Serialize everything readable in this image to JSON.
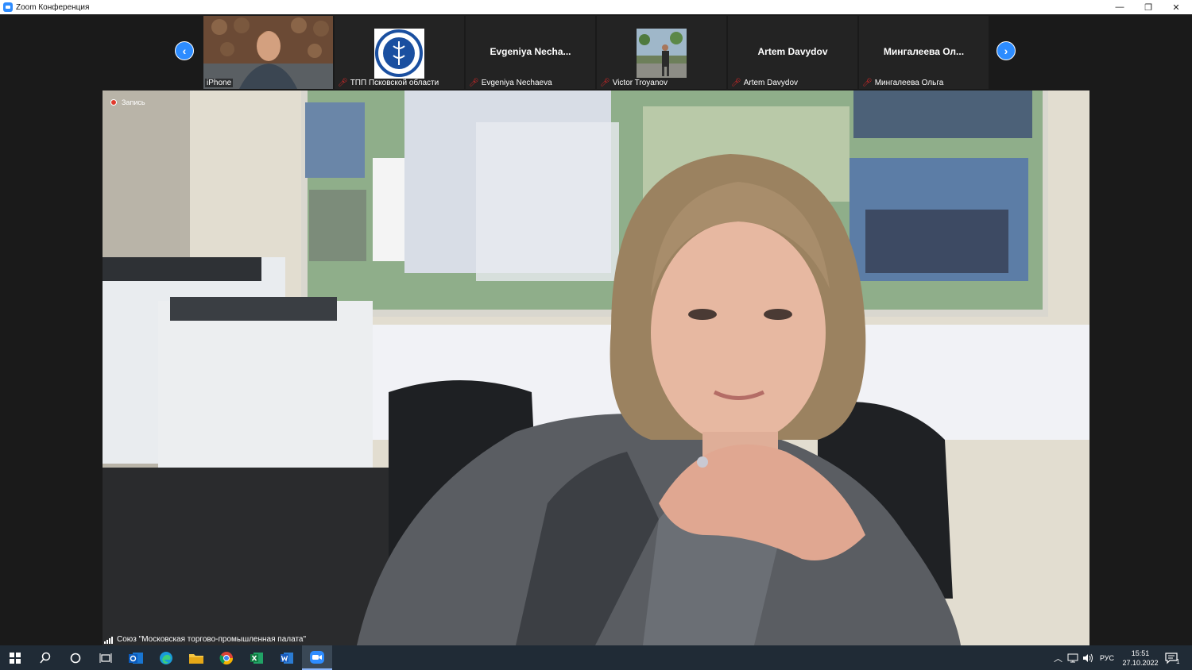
{
  "window": {
    "title": "Zoom Конференция"
  },
  "window_controls": {
    "minimize": "—",
    "restore": "❐",
    "close": "✕"
  },
  "participants": [
    {
      "name": "iPhone",
      "display": ""
    },
    {
      "name": "ТПП Псковской области",
      "display": ""
    },
    {
      "name": "Evgeniya Nechaeva",
      "display": "Evgeniya  Necha..."
    },
    {
      "name": "Victor Troyanov",
      "display": ""
    },
    {
      "name": "Artem Davydov",
      "display": "Artem Davydov"
    },
    {
      "name": "Мингалеева Ольга",
      "display": "Мингалеева  Ол..."
    }
  ],
  "nav": {
    "prev_icon": "chevron-left-icon",
    "next_icon": "chevron-right-icon"
  },
  "main": {
    "recording_label": "Запись",
    "speaker_name": "Союз \"Московская торгово-промышленная палата\""
  },
  "taskbar": {
    "language": "РУС",
    "time": "15:51",
    "date": "27.10.2022",
    "notification_count": "1"
  },
  "colors": {
    "accent": "#2d8cff",
    "mic_muted": "#e02828",
    "recording": "#e13a2d"
  }
}
